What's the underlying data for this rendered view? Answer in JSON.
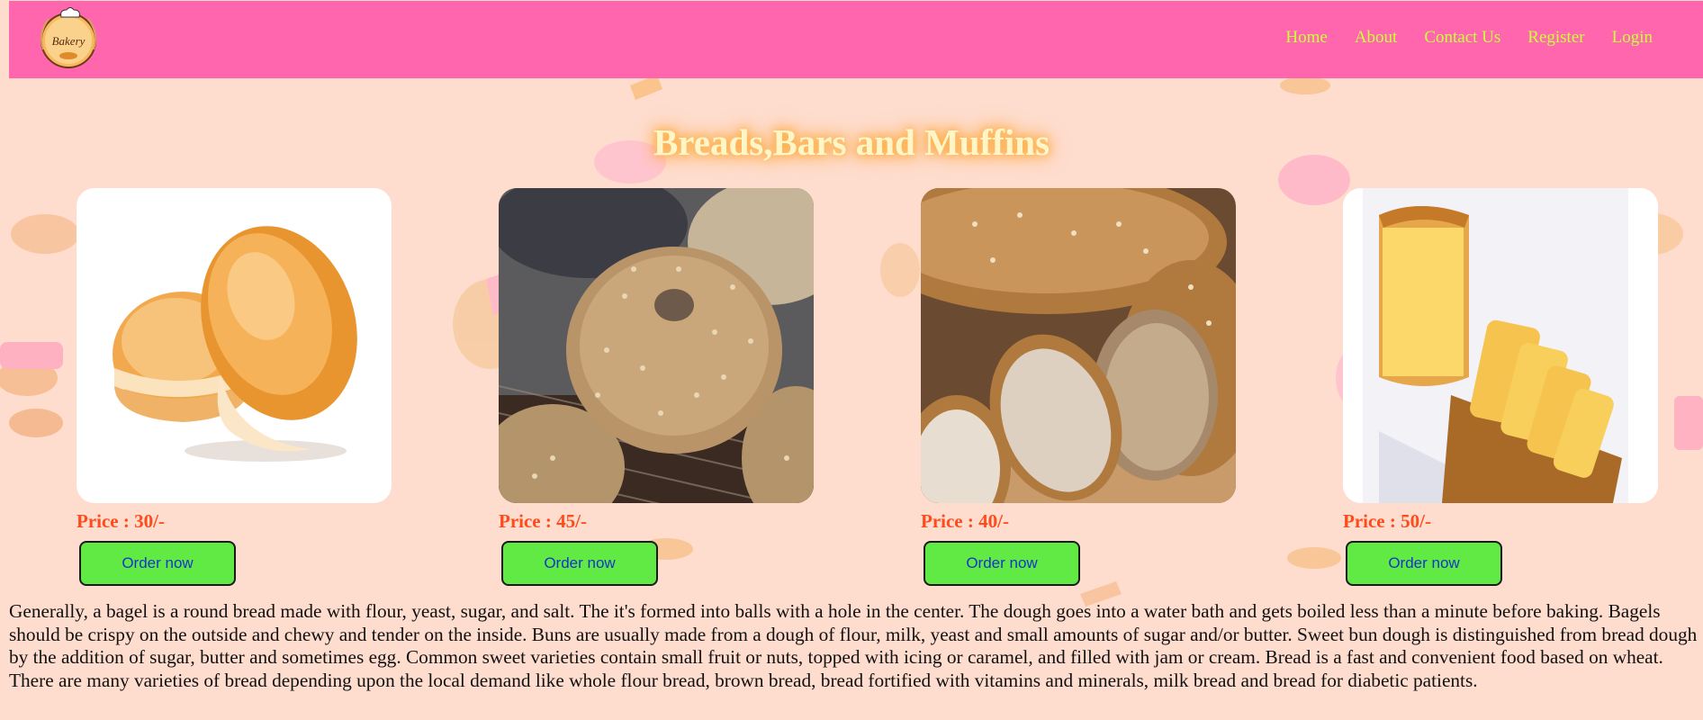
{
  "brand": {
    "logo_text": "Bakery"
  },
  "nav": {
    "items": [
      "Home",
      "About",
      "Contact Us",
      "Register",
      "Login"
    ]
  },
  "title": "Breads,Bars and Muffins",
  "products": [
    {
      "price": "Price : 30/-",
      "button": "Order now",
      "image": "buns"
    },
    {
      "price": "Price : 45/-",
      "button": "Order now",
      "image": "sesame-bagel"
    },
    {
      "price": "Price : 40/-",
      "button": "Order now",
      "image": "multigrain-bread"
    },
    {
      "price": "Price : 50/-",
      "button": "Order now",
      "image": "sliced-loaf"
    }
  ],
  "description": "Generally, a bagel is a round bread made with flour, yeast, sugar, and salt. The it's formed into balls with a hole in the center. The dough goes into a water bath and gets boiled less than a minute before baking. Bagels should be crispy on the outside and chewy and tender on the inside. Buns are usually made from a dough of flour, milk, yeast and small amounts of sugar and/or butter. Sweet bun dough is distinguished from bread dough by the addition of sugar, butter and sometimes egg. Common sweet varieties contain small fruit or nuts, topped with icing or caramel, and filled with jam or cream. Bread is a fast and convenient food based on wheat. There are many varieties of bread depending upon the local demand like whole flour bread, brown bread, bread fortified with vitamins and minerals, milk bread and bread for diabetic patients.",
  "colors": {
    "navbar": "#ff66ad",
    "nav_link": "#c9ff3a",
    "background": "#fedcce",
    "price": "#ff4a1a",
    "button": "#62ea44",
    "button_text": "#1436c8"
  }
}
